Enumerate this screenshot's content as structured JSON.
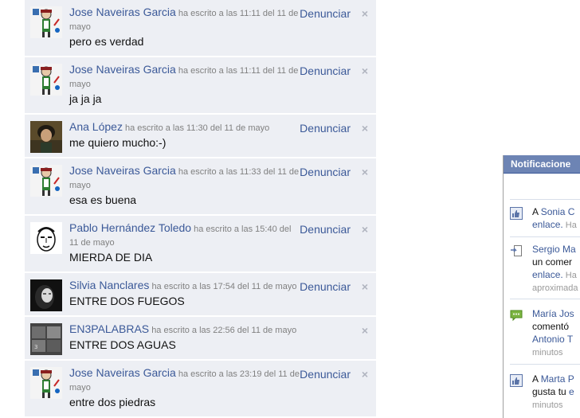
{
  "wall": {
    "posts": [
      {
        "author": "Jose Naveiras Garcia",
        "meta": "ha escrito a las 11:11 del 11 de mayo",
        "message": "pero es verdad",
        "report_label": "Denunciar",
        "close_glyph": "×",
        "avatar": "jose-avatar"
      },
      {
        "author": "Jose Naveiras Garcia",
        "meta": "ha escrito a las 11:11 del 11 de mayo",
        "message": "ja ja ja",
        "report_label": "Denunciar",
        "close_glyph": "×",
        "avatar": "jose-avatar"
      },
      {
        "author": "Ana López",
        "meta": "ha escrito a las 11:30 del 11 de mayo",
        "message": "me quiero mucho:-)",
        "report_label": "Denunciar",
        "close_glyph": "×",
        "avatar": "ana-avatar"
      },
      {
        "author": "Jose Naveiras Garcia",
        "meta": "ha escrito a las 11:33 del 11 de mayo",
        "message": "esa es buena",
        "report_label": "Denunciar",
        "close_glyph": "×",
        "avatar": "jose-avatar"
      },
      {
        "author": "Pablo Hernández Toledo",
        "meta": "ha escrito a las 15:40 del 11 de mayo",
        "message": "MIERDA DE DIA",
        "report_label": "Denunciar",
        "close_glyph": "×",
        "avatar": "pablo-avatar"
      },
      {
        "author": "Silvia Nanclares",
        "meta": "ha escrito a las 17:54 del 11 de mayo",
        "message": "ENTRE DOS FUEGOS",
        "report_label": "Denunciar",
        "close_glyph": "×",
        "avatar": "silvia-avatar"
      },
      {
        "author": "EN3PALABRAS",
        "meta": "ha escrito a las 22:56 del 11 de mayo",
        "message": "ENTRE DOS AGUAS",
        "report_label": "",
        "close_glyph": "×",
        "avatar": "en3palabras-avatar"
      },
      {
        "author": "Jose Naveiras Garcia",
        "meta": "ha escrito a las 23:19 del 11 de mayo",
        "message": "entre dos piedras",
        "report_label": "Denunciar",
        "close_glyph": "×",
        "avatar": "jose-avatar"
      }
    ]
  },
  "notifications": {
    "title": "Notificacione",
    "items": [
      {
        "icon": "like-icon",
        "line1_prefix": "A ",
        "line1_link": "Sonia C",
        "line2_link": "enlace.",
        "line2_gray": " Ha"
      },
      {
        "icon": "share-icon",
        "line1_link": "Sergio Ma",
        "line2_text": "un comer",
        "line3_link": "enlace.",
        "line3_gray": " Ha",
        "line4_gray": "aproximada"
      },
      {
        "icon": "comment-icon",
        "line1_link": "María Jos",
        "line2_text": "comentó",
        "line3_link": "Antonio T",
        "line4_gray": "minutos"
      },
      {
        "icon": "like-icon",
        "line1_prefix": "A ",
        "line1_link": "Marta P",
        "line2_text": "gusta tu ",
        "line2_link": "e",
        "line3_gray": "minutos"
      }
    ]
  },
  "colors": {
    "link": "#3b5998",
    "post_bg": "#edeff4",
    "header_bg": "#6d84b4"
  }
}
